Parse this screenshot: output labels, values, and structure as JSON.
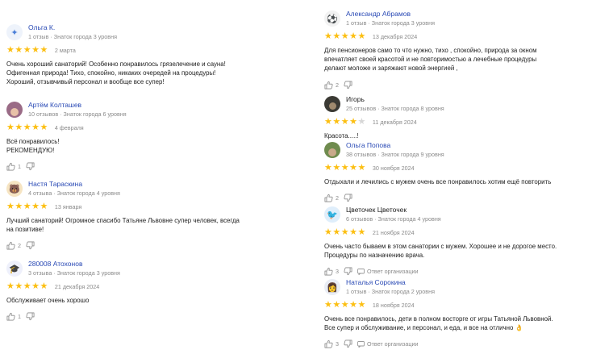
{
  "left": [
    {
      "name": "Ольга К.",
      "stats": "1 отзыв · Знаток города 3 уровня",
      "date": "2 марта",
      "stars": 5,
      "text": [
        "Очень хороший санаторий! Особенно понравилось грязелечение и сауна!",
        "Офигенная природа! Тихо, спокойно, никаких очередей на процедуры!",
        "Хороший, отзывчивый персонал и вообще все супер!"
      ],
      "likes": "",
      "avatar_icon": "sparkle-icon",
      "avatar_color": "#eef3fb"
    },
    {
      "name": "Артём Колташев",
      "stats": "10 отзывов · Знаток города 6 уровня",
      "date": "4 февраля",
      "stars": 5,
      "text": [
        "Всё понравилось!",
        "РЕКОМЕНДУЮ!"
      ],
      "likes": "1",
      "avatar_icon": "user-photo",
      "avatar_color": "#9a6b86"
    },
    {
      "name": "Настя Тараскина",
      "stats": "4 отзыва · Знаток города 4 уровня",
      "date": "13 января",
      "stars": 5,
      "text": [
        "Лучший санаторий! Огромное спасибо Татьяне Львовне супер человек, всегда",
        "на позитиве!"
      ],
      "likes": "2",
      "avatar_icon": "bear-icon",
      "avatar_color": "#f6e4c2"
    },
    {
      "name": "280008 Атохонов",
      "stats": "3 отзыва · Знаток города 3 уровня",
      "date": "21 декабря 2024",
      "stars": 5,
      "text": [
        "Обслуживает очень хорошо"
      ],
      "likes": "1",
      "avatar_icon": "graduation-cap-icon",
      "avatar_color": "#eef0fb"
    }
  ],
  "right": [
    {
      "name": "Александр Абрамов",
      "stats": "1 отзыв · Знаток города 3 уровня",
      "date": "13 декабря 2024",
      "stars": 5,
      "text": [
        "Для пенсионеров само то что нужно, тихо , спокойно, природа за окном",
        "впечатляет своей красотой и не повторимостью а лечебные процедуры",
        "делают моложе и заряжают новой энергией ,"
      ],
      "likes": "2",
      "avatar_icon": "soccer-ball-icon",
      "avatar_color": "#f2f2f2"
    },
    {
      "name": "Игорь",
      "stats": "25 отзывов · Знаток города 8 уровня",
      "date": "11 декабря 2024",
      "stars": 4,
      "text": [
        "Красота.....!"
      ],
      "likes": "",
      "avatar_icon": "user-photo",
      "avatar_color": "#3b3a34"
    },
    {
      "name": "Ольга Попова",
      "stats": "38 отзывов · Знаток города 9 уровня",
      "date": "30 ноября 2024",
      "stars": 5,
      "text": [
        "Отдыхали и лечились с мужем очень все понравилось хотим ещё повторить"
      ],
      "likes": "2",
      "avatar_icon": "user-photo",
      "avatar_color": "#6f8b4e"
    },
    {
      "name": "Цветочек Цветочек",
      "stats": "6 отзывов · Знаток города 4 уровня",
      "date": "21 ноября 2024",
      "stars": 5,
      "text": [
        "Очень часто бываем в этом санатории с мужем. Хорошее и не дорогое место.",
        "Процедуры по назначению врача."
      ],
      "likes": "3",
      "org_reply": "Ответ организации",
      "avatar_icon": "bird-icon",
      "avatar_color": "#dfeefb"
    },
    {
      "name": "Наталья Сорокина",
      "stats": "1 отзыв · Знаток города 2 уровня",
      "date": "18 ноября 2024",
      "stars": 5,
      "text": [
        "Очень все понравилось, дети в полном восторге от игры Татьяной Львовной.",
        "Все супер и обслуживание, и персонал, и еда, и все на отлично 👌"
      ],
      "likes": "3",
      "org_reply": "Ответ организации",
      "avatar_icon": "person-icon",
      "avatar_color": "#e9edf5"
    }
  ]
}
